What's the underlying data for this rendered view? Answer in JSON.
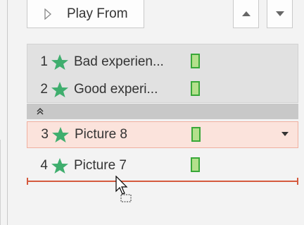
{
  "toolbar": {
    "play_from_label": "Play From",
    "play_icon": "play-triangle-icon",
    "move_up_icon": "triangle-up-icon",
    "move_down_icon": "triangle-down-icon"
  },
  "animation_pane": {
    "items": [
      {
        "number": "1",
        "icon": "star-icon",
        "label": "Bad experien...",
        "group": "collapsed-group"
      },
      {
        "number": "2",
        "icon": "star-icon",
        "label": "Good experi...",
        "group": "collapsed-group"
      },
      {
        "number": "3",
        "icon": "star-icon",
        "label": "Picture 8",
        "selected": true
      },
      {
        "number": "4",
        "icon": "star-icon",
        "label": "Picture 7"
      }
    ],
    "collapse_glyph": "»",
    "colors": {
      "star": "#3fae6e",
      "timing_bar_fill": "#b4e08c",
      "timing_bar_border": "#39a839",
      "selected_row": "#fbe3dc",
      "insert_line": "#d55a3e"
    }
  }
}
